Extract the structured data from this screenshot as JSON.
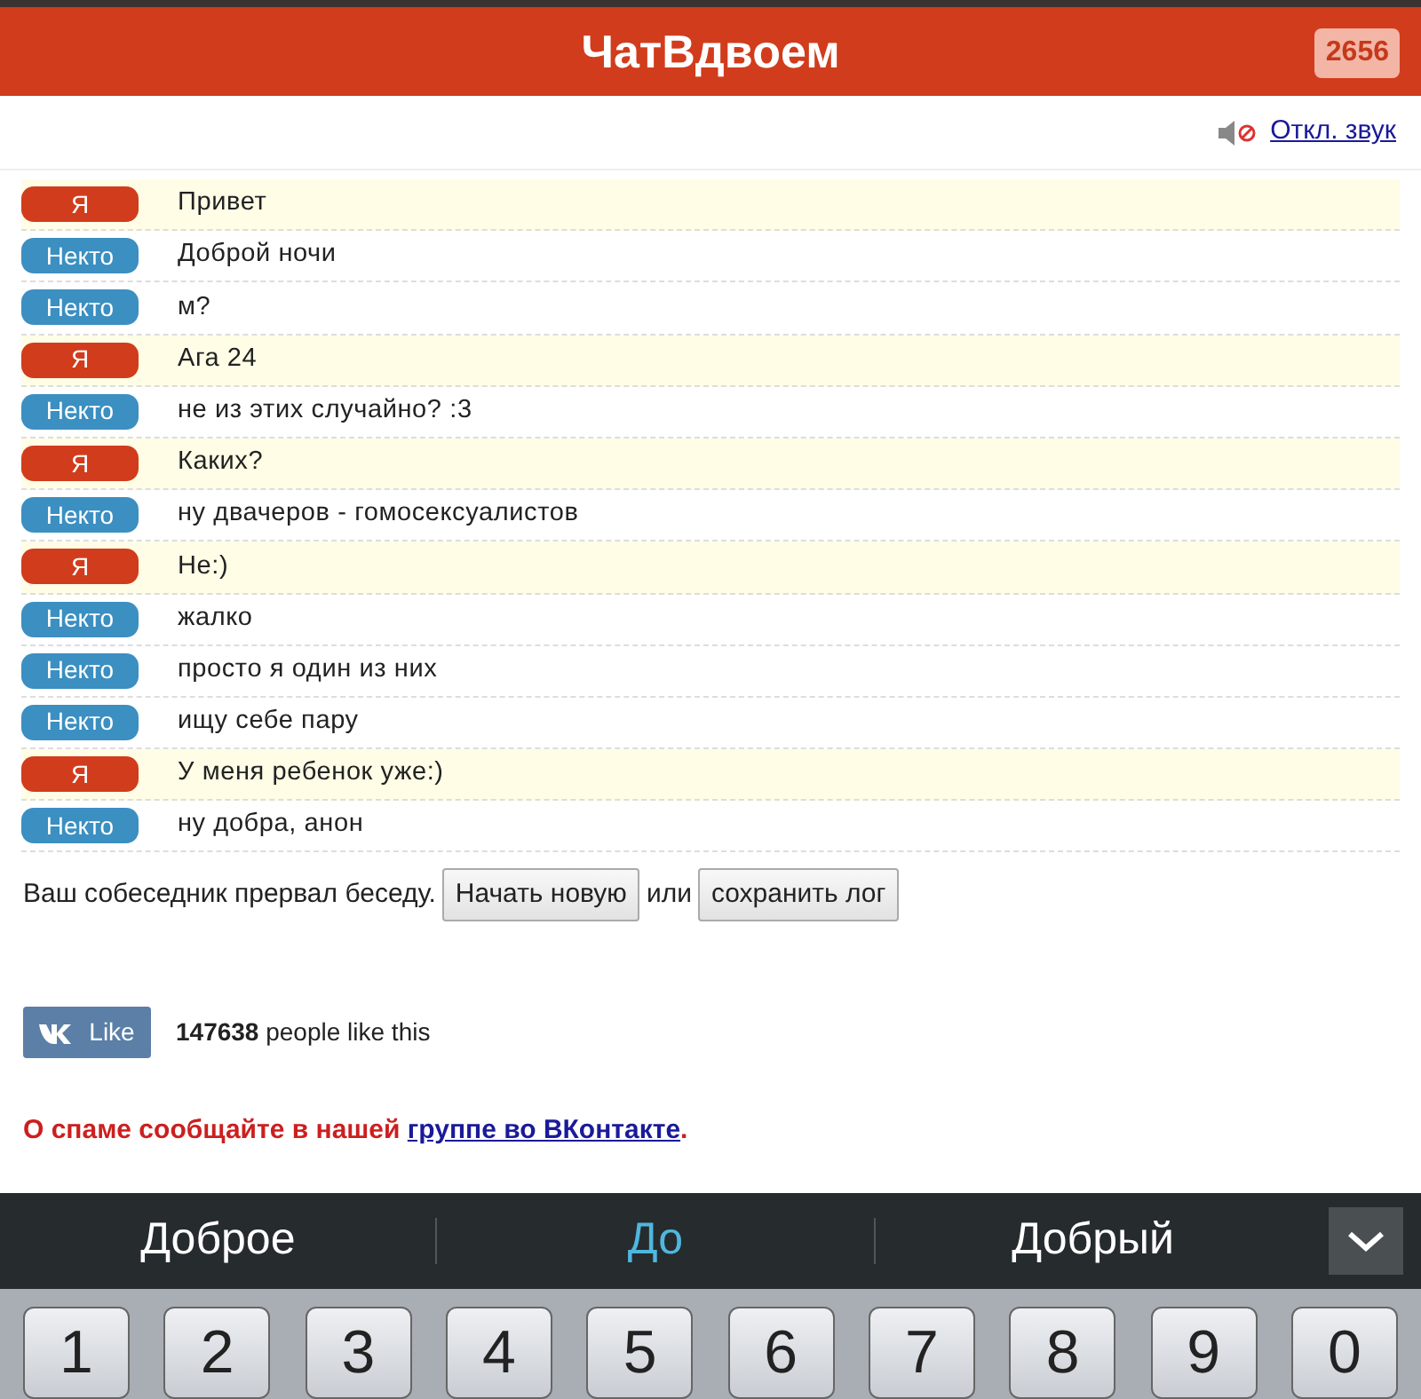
{
  "header": {
    "title": "ЧатВдвоем",
    "online_count": "2656"
  },
  "mute_link": "Откл. звук",
  "messages": [
    {
      "kind": "me",
      "author": "Я",
      "text": "Привет"
    },
    {
      "kind": "stranger",
      "author": "Некто",
      "text": "Доброй ночи"
    },
    {
      "kind": "stranger",
      "author": "Некто",
      "text": "м?"
    },
    {
      "kind": "me",
      "author": "Я",
      "text": "Ага 24"
    },
    {
      "kind": "stranger",
      "author": "Некто",
      "text": "не из этих случайно? :3"
    },
    {
      "kind": "me",
      "author": "Я",
      "text": "Каких?"
    },
    {
      "kind": "stranger",
      "author": "Некто",
      "text": "ну двачеров - гомосексуалистов"
    },
    {
      "kind": "me",
      "author": "Я",
      "text": "Не:)"
    },
    {
      "kind": "stranger",
      "author": "Некто",
      "text": "жалко"
    },
    {
      "kind": "stranger",
      "author": "Некто",
      "text": "просто я один из них"
    },
    {
      "kind": "stranger",
      "author": "Некто",
      "text": "ищу себе пару"
    },
    {
      "kind": "me",
      "author": "Я",
      "text": "У меня ребенок уже:)"
    },
    {
      "kind": "stranger",
      "author": "Некто",
      "text": "ну добра, анон"
    }
  ],
  "ended": {
    "notice": "Ваш собеседник прервал беседу.",
    "new_button": "Начать новую",
    "or": "или",
    "save_button": "сохранить лог"
  },
  "like": {
    "button": "Like",
    "text": "**147638** people like this"
  },
  "spam": {
    "text": "О спаме сообщайте в нашей",
    "link": "группе во ВКонтакте",
    "end": "."
  },
  "keyboard": {
    "suggestions": [
      {
        "label": "Доброе",
        "selected": false
      },
      {
        "label": "До",
        "selected": true
      },
      {
        "label": "Добрый",
        "selected": false
      }
    ],
    "keys": [
      "1",
      "2",
      "3",
      "4",
      "5",
      "6",
      "7",
      "8",
      "9",
      "0"
    ]
  }
}
